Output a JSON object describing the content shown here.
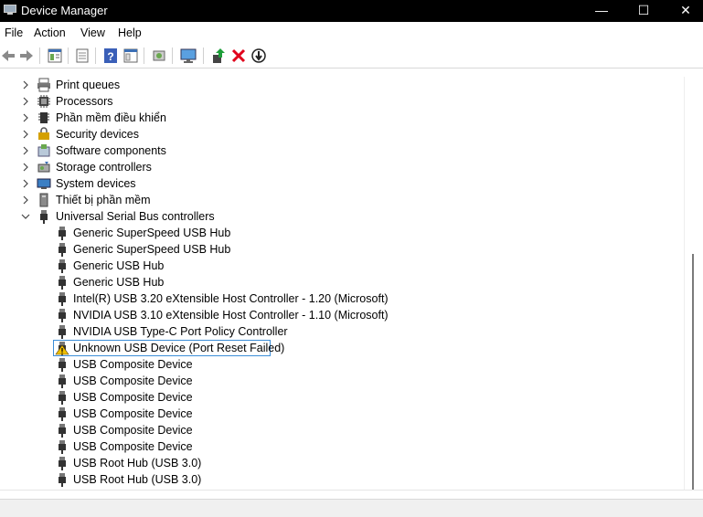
{
  "window": {
    "title": "Device Manager",
    "minimize": "—",
    "maximize": "☐",
    "close": "✕"
  },
  "menu": [
    {
      "label": "File"
    },
    {
      "label": "Action"
    },
    {
      "label": "View"
    },
    {
      "label": "Help"
    }
  ],
  "toolbar": {
    "icons": [
      "back-icon",
      "forward-icon",
      "properties-icon",
      "show-hide-icon",
      "help-icon",
      "view-icon",
      "scan-icon",
      "monitor-icon",
      "update-driver-icon",
      "uninstall-icon",
      "disable-icon"
    ]
  },
  "tree": {
    "categories": [
      {
        "label": "Print queues",
        "icon": "printer-icon",
        "expanded": false
      },
      {
        "label": "Processors",
        "icon": "processor-icon",
        "expanded": false
      },
      {
        "label": "Phần mềm điều khiển",
        "icon": "firmware-icon",
        "expanded": false
      },
      {
        "label": "Security devices",
        "icon": "security-icon",
        "expanded": false
      },
      {
        "label": "Software components",
        "icon": "software-components-icon",
        "expanded": false
      },
      {
        "label": "Storage controllers",
        "icon": "storage-icon",
        "expanded": false
      },
      {
        "label": "System devices",
        "icon": "system-devices-icon",
        "expanded": false
      },
      {
        "label": "Thiết bị phần mềm",
        "icon": "software-device-icon",
        "expanded": false
      },
      {
        "label": "Universal Serial Bus controllers",
        "icon": "usb-icon",
        "expanded": true
      }
    ],
    "usb_devices": [
      {
        "label": "Generic SuperSpeed USB Hub",
        "warning": false
      },
      {
        "label": "Generic SuperSpeed USB Hub",
        "warning": false
      },
      {
        "label": "Generic USB Hub",
        "warning": false
      },
      {
        "label": "Generic USB Hub",
        "warning": false
      },
      {
        "label": "Intel(R) USB 3.20 eXtensible Host Controller - 1.20 (Microsoft)",
        "warning": false
      },
      {
        "label": "NVIDIA USB 3.10 eXtensible Host Controller - 1.10 (Microsoft)",
        "warning": false
      },
      {
        "label": "NVIDIA USB Type-C Port Policy Controller",
        "warning": false
      },
      {
        "label": "Unknown USB Device (Port Reset Failed)",
        "warning": true,
        "selected": true
      },
      {
        "label": "USB Composite Device",
        "warning": false
      },
      {
        "label": "USB Composite Device",
        "warning": false
      },
      {
        "label": "USB Composite Device",
        "warning": false
      },
      {
        "label": "USB Composite Device",
        "warning": false
      },
      {
        "label": "USB Composite Device",
        "warning": false
      },
      {
        "label": "USB Composite Device",
        "warning": false
      },
      {
        "label": "USB Root Hub (USB 3.0)",
        "warning": false
      },
      {
        "label": "USB Root Hub (USB 3.0)",
        "warning": false
      }
    ]
  },
  "colors": {
    "titlebar": "#000000",
    "selection_border": "#3c8ed8",
    "warning": "#f0c000",
    "uninstall": "#e0001b",
    "update_green": "#1e9e3a"
  }
}
